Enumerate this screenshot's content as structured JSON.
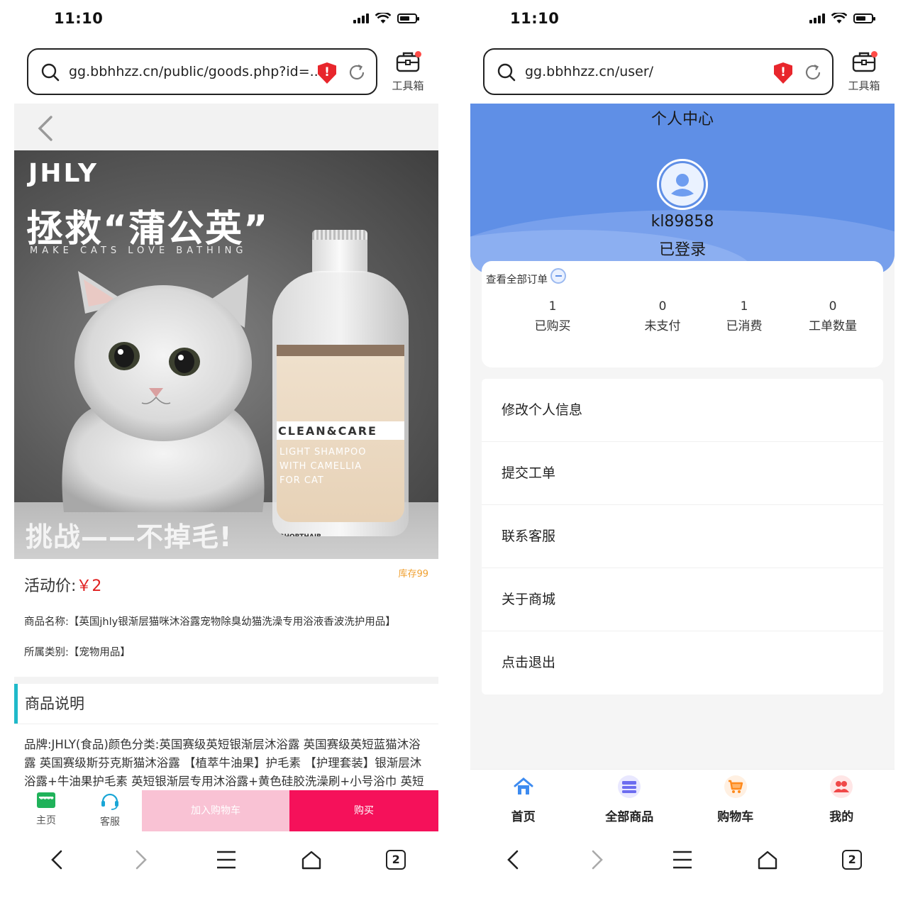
{
  "left": {
    "status": {
      "time": "11:10"
    },
    "browser": {
      "url": "gg.bbhhzz.cn/public/goods.php?id=...",
      "toolbox_label": "工具箱",
      "tab_count": "2"
    },
    "hero": {
      "brand": "JHLY",
      "headline": "拯救“蒲公英”",
      "tagline": "MAKE CATS LOVE BATHING",
      "bottle_brand": "CLEAN&CARE",
      "bottle_line1": "LIGHT SHAMPOO",
      "bottle_line2": "WITH CAMELLIA",
      "bottle_line3": "FOR CAT",
      "bottle_type": "SHORTHAIR",
      "challenge": "挑战——不掉毛!"
    },
    "product": {
      "price_label": "活动价:",
      "price_value": "￥2",
      "stock": "库存99",
      "name_line": "商品名称:【英国jhly银渐层猫咪沐浴露宠物除臭幼猫洗澡专用浴液香波洗护用品】",
      "category_line": "所属类别:【宠物用品】",
      "section_title": "商品说明",
      "description": "品牌:JHLY(食品)颜色分类:英国赛级英短银渐层沐浴露 英国赛级英短蓝猫沐浴露 英国赛级斯芬克斯猫沐浴露 【植萃牛油果】护毛素 【护理套装】银渐层沐浴露+牛油果护毛素 英短银渐层专用沐浴露+黄色硅胶洗澡刷+小号浴巾 英短银渐层专用沐浴露+粉色硅胶洗澡刷+小号浴巾 英短"
    },
    "actions": {
      "home_label": "主页",
      "service_label": "客服",
      "add_cart_label": "加入购物车",
      "buy_label": "购买"
    }
  },
  "right": {
    "status": {
      "time": "11:10"
    },
    "browser": {
      "url": "gg.bbhhzz.cn/user/",
      "toolbox_label": "工具箱",
      "tab_count": "2"
    },
    "profile": {
      "title": "个人中心",
      "username": "kl89858",
      "login_status": "已登录"
    },
    "orders": {
      "link_label": "查看全部订单",
      "stats": [
        {
          "value": "1",
          "label": "已购买"
        },
        {
          "value": "0",
          "label": "未支付"
        },
        {
          "value": "1",
          "label": "已消费"
        },
        {
          "value": "0",
          "label": "工单数量"
        }
      ]
    },
    "menu": [
      {
        "label": "修改个人信息"
      },
      {
        "label": "提交工单"
      },
      {
        "label": "联系客服"
      },
      {
        "label": "关于商城"
      },
      {
        "label": "点击退出"
      }
    ],
    "tabs": [
      {
        "label": "首页",
        "icon": "home-icon",
        "color": "#3d8bf0"
      },
      {
        "label": "全部商品",
        "icon": "goods-icon",
        "color": "#6c6cf0"
      },
      {
        "label": "购物车",
        "icon": "cart-icon",
        "color": "#ff8a1c"
      },
      {
        "label": "我的",
        "icon": "user-group-icon",
        "color": "#f04848"
      }
    ]
  }
}
